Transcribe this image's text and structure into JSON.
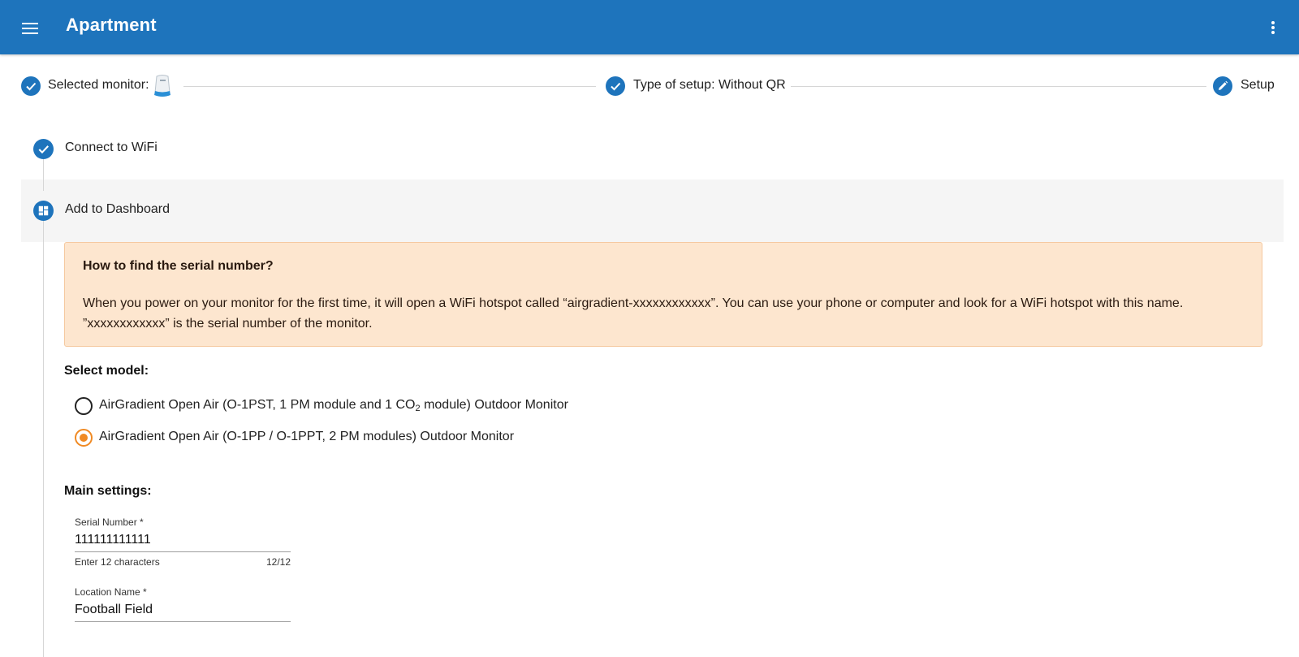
{
  "appbar": {
    "title": "Apartment",
    "menu_icon": "hamburger-menu-icon",
    "more_icon": "more-vert-icon"
  },
  "stepper": {
    "steps": [
      {
        "label": "Selected monitor:",
        "icon": "check-icon",
        "image": "monitor-device-icon"
      },
      {
        "label": "Type of setup: Without QR",
        "icon": "check-icon"
      },
      {
        "label": "Setup",
        "icon": "edit-pencil-icon"
      }
    ]
  },
  "vertical_steps": [
    {
      "label": "Connect to WiFi",
      "icon": "check-icon"
    },
    {
      "label": "Add to Dashboard",
      "icon": "dashboard-icon"
    }
  ],
  "info_box": {
    "title": "How to find the serial number?",
    "text": "When you power on your monitor for the first time, it will open a WiFi hotspot called “airgradient-xxxxxxxxxxxx”. You can use your phone or computer and look for a WiFi hotspot with this name. ”xxxxxxxxxxxx” is the serial number of the monitor."
  },
  "select_model": {
    "title": "Select model:",
    "options": [
      {
        "label_pre": "AirGradient Open Air (O-1PST, 1 PM module and 1 CO",
        "label_sub": "2",
        "label_post": " module) Outdoor Monitor",
        "selected": false
      },
      {
        "label": "AirGradient Open Air (O-1PP / O-1PPT, 2 PM modules) Outdoor Monitor",
        "selected": true
      }
    ]
  },
  "main_settings": {
    "title": "Main settings:",
    "serial_number": {
      "label": "Serial Number *",
      "value": "111111111111",
      "helper": "Enter 12 characters",
      "counter": "12/12"
    },
    "location_name": {
      "label": "Location Name *",
      "value": "Football Field"
    }
  },
  "colors": {
    "primary": "#1e74bc",
    "accent": "#f08a24",
    "info_bg": "#fde6cf"
  }
}
